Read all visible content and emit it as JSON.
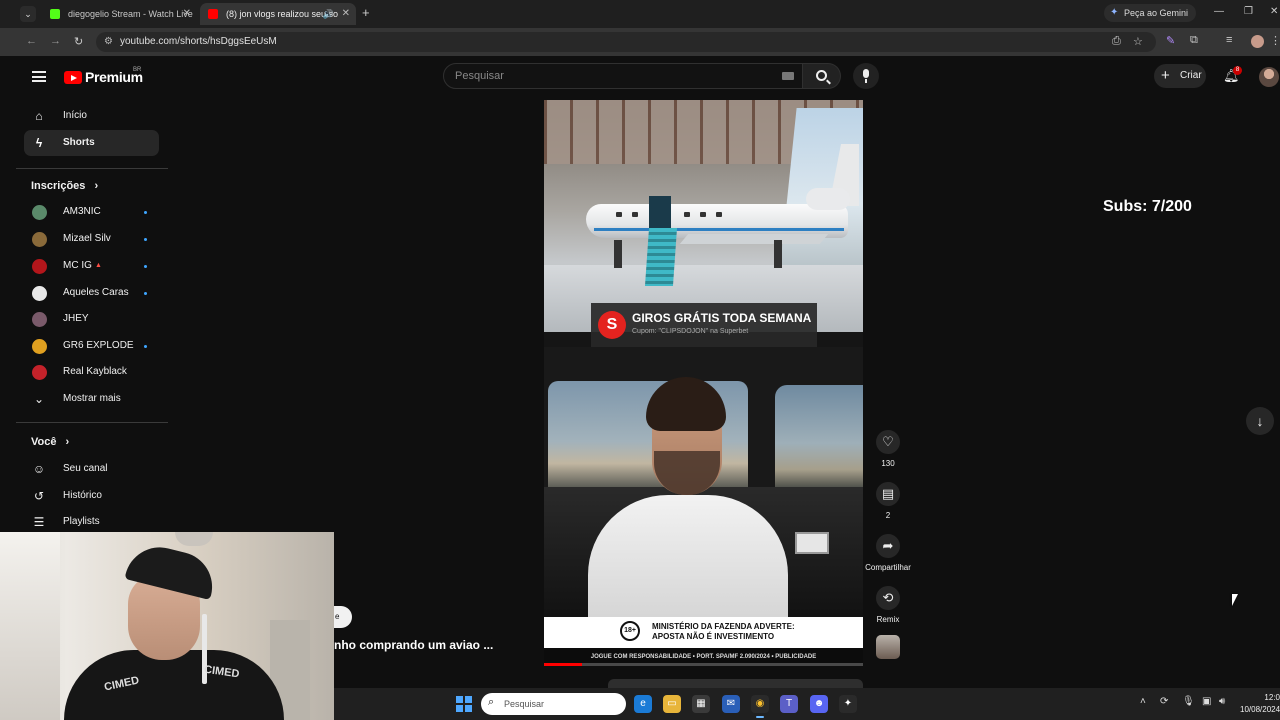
{
  "browser": {
    "tabs": [
      {
        "title": "diegogelio Stream - Watch Live",
        "favicon_color": "#53fc18"
      },
      {
        "title": "(8) jon vlogs realizou seu so",
        "favicon_color": "#ff0000"
      }
    ],
    "gemini_label": "Peça ao Gemini",
    "url": "youtube.com/shorts/hsDggsEeUsM"
  },
  "youtube": {
    "logo_text": "Premium",
    "country_code": "BR",
    "search_placeholder": "Pesquisar",
    "create_label": "Criar",
    "notification_count": "8"
  },
  "sidebar": {
    "main": [
      {
        "label": "Início",
        "icon": "home-icon"
      },
      {
        "label": "Shorts",
        "icon": "shorts-icon",
        "active": true
      }
    ],
    "subscriptions_header": "Inscrições",
    "subscriptions": [
      {
        "label": "AM3NIC",
        "avatar_color": "#5a8a6a",
        "new": true
      },
      {
        "label": "Mizael Silv",
        "avatar_color": "#8a6a3a",
        "new": true
      },
      {
        "label": "MC IG",
        "avatar_color": "#b4161b",
        "new": true,
        "live": true
      },
      {
        "label": "Aqueles Caras",
        "avatar_color": "#e8e8e8",
        "new": true
      },
      {
        "label": "JHEY",
        "avatar_color": "#7a5a6a",
        "new": false
      },
      {
        "label": "GR6 EXPLODE",
        "avatar_color": "#e0a020",
        "new": true
      },
      {
        "label": "Real Kayblack",
        "avatar_color": "#c4222a",
        "new": false
      }
    ],
    "show_more": "Mostrar mais",
    "you_header": "Você",
    "you": [
      {
        "label": "Seu canal",
        "icon": "account-icon"
      },
      {
        "label": "Histórico",
        "icon": "history-icon"
      },
      {
        "label": "Playlists",
        "icon": "playlists-icon"
      }
    ]
  },
  "short": {
    "promo_title": "GIROS GRÁTIS TODA SEMANA",
    "promo_sub": "Cupom: \"CLIPSDOJON\" na Superbet",
    "warning_age": "18+",
    "warning_line1": "MINISTÉRIO DA FAZENDA ADVERTE:",
    "warning_line2": "APOSTA NÃO É INVESTIMENTO",
    "responsibility": "JOGUE COM RESPONSABILIDADE • PORT. SPA/MF 2.090/2024 • PUBLICIDADE",
    "progress": 0.12,
    "title": "nho comprando um aviao ..."
  },
  "actions": {
    "likes": "130",
    "comments": "2",
    "share_label": "Compartilhar",
    "remix_label": "Remix"
  },
  "overlay": {
    "subs_counter": "Subs: 7/200",
    "shirt_text_left": "CIMED",
    "shirt_text_right": "CIMED",
    "caption_bubble": "e"
  },
  "taskbar": {
    "search_placeholder": "Pesquisar",
    "time": "12:0",
    "date": "10/08/2024"
  }
}
